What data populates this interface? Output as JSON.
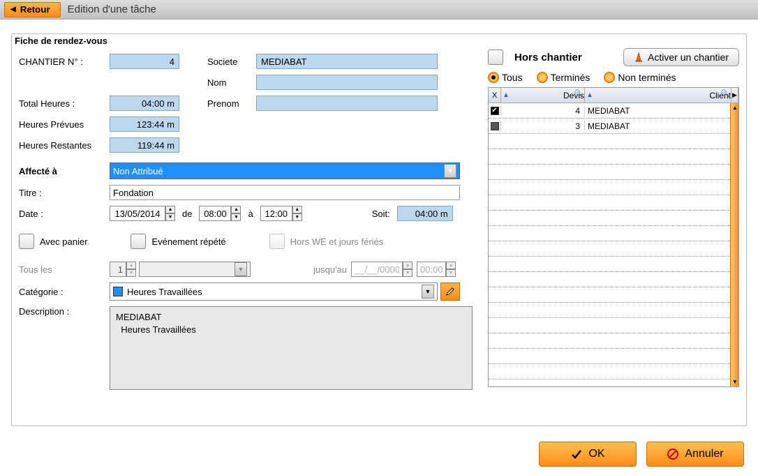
{
  "header": {
    "back": "Retour",
    "title": "Edition d'une tâche"
  },
  "fiche_label": "Fiche de rendez-vous",
  "labels": {
    "chantier": "CHANTIER N° :",
    "societe": "Societe",
    "nom": "Nom",
    "prenom": "Prenom",
    "total_heures": "Total Heures :",
    "heures_prevues": "Heures Prévues",
    "heures_restantes": "Heures Restantes",
    "affecte": "Affecté à",
    "titre": "Titre :",
    "date": "Date :",
    "de": "de",
    "a": "à",
    "soit": "Soit:",
    "avec_panier": "Avec panier",
    "evenement_repete": "Evénement répété",
    "hors_we": "Hors WE et jours fériés",
    "tous_les": "Tous les",
    "jusquau": "jusqu'au",
    "categorie": "Catégorie :",
    "description": "Description :"
  },
  "values": {
    "chantier_n": "4",
    "societe": "MEDIABAT",
    "nom": "",
    "prenom": "",
    "total_heures": "04:00 m",
    "heures_prevues": "123:44 m",
    "heures_restantes": "119:44 m",
    "affecte": "Non Attribué",
    "titre": "Fondation",
    "date": "13/05/2014",
    "heure_de": "08:00",
    "heure_a": "12:00",
    "soit": "04:00 m",
    "tous_les_n": "1",
    "jusquau_date": "__/__/0000",
    "jusquau_heure": "00:00",
    "categorie": "Heures Travaillées",
    "description_l1": "MEDIABAT",
    "description_l2": "  Heures Travaillées"
  },
  "right": {
    "hors_chantier": "Hors chantier",
    "activer": "Activer un chantier",
    "radio_tous": "Tous",
    "radio_termines": "Terminés",
    "radio_non_termines": "Non terminés",
    "col_x": "X",
    "col_devis": "Devis",
    "col_client": "Client",
    "rows": [
      {
        "checked": true,
        "devis": "4",
        "client": "MEDIABAT"
      },
      {
        "checked": false,
        "devis": "3",
        "client": "MEDIABAT"
      }
    ]
  },
  "buttons": {
    "ok": "OK",
    "annuler": "Annuler"
  }
}
